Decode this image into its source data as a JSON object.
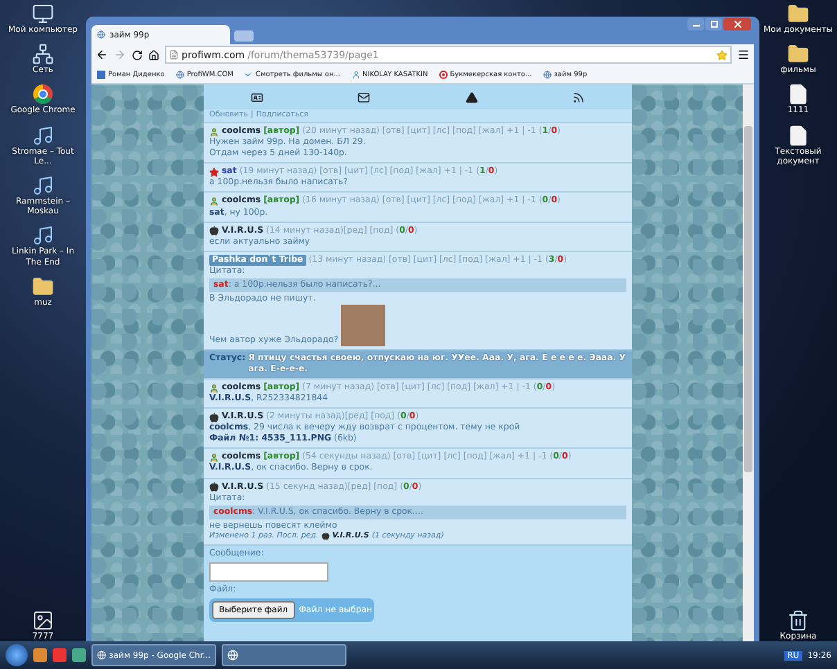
{
  "desktop_left": [
    {
      "kind": "computer",
      "label": "Мой компьютер"
    },
    {
      "kind": "network",
      "label": "Сеть"
    },
    {
      "kind": "chrome",
      "label": "Google Chrome"
    },
    {
      "kind": "audio",
      "label": "Stromae – Tout Le..."
    },
    {
      "kind": "audio",
      "label": "Rammstein – Moskau"
    },
    {
      "kind": "audio",
      "label": "Linkin Park – In The End"
    },
    {
      "kind": "folder",
      "label": "muz"
    },
    {
      "kind": "spacer"
    },
    {
      "kind": "image",
      "label": "7777"
    }
  ],
  "desktop_right": [
    {
      "kind": "docs",
      "label": "Мои документы"
    },
    {
      "kind": "folder",
      "label": "фильмы"
    },
    {
      "kind": "file",
      "label": "1111"
    },
    {
      "kind": "file",
      "label": "Текстовый документ"
    },
    {
      "kind": "spacer"
    },
    {
      "kind": "trash",
      "label": "Корзина"
    }
  ],
  "browser": {
    "tab_title": "займ 99р",
    "url_host": "profiwm.com",
    "url_path": "/forum/thema53739/page1",
    "bookmarks": [
      {
        "kind": "square",
        "label": "Роман Диденко"
      },
      {
        "kind": "globe",
        "label": "ProfiWM.COM"
      },
      {
        "kind": "bird",
        "label": "Смотреть фильмы он..."
      },
      {
        "kind": "person",
        "label": "NIKOLAY KASATKIN"
      },
      {
        "kind": "target",
        "label": "Букмекерская конто..."
      },
      {
        "kind": "globe",
        "label": "займ 99р"
      }
    ]
  },
  "forum": {
    "links": [
      "Обновить",
      "Подписаться"
    ],
    "link_separator": "|",
    "vote_marks": {
      "open": "(",
      "sep": "/",
      "close": ")"
    },
    "posts": [
      {
        "kind": "user",
        "author": "coolcms",
        "tag": "[автор]",
        "meta": "(20 минут назад) [отв] [цит] [лс] [под] [жал] +1 | -1",
        "up": "1",
        "down": "0",
        "body": [
          {
            "kind": "text",
            "text": "Нужен займ 99р. На домен. БЛ 29."
          },
          {
            "kind": "text",
            "text": "Отдам через 5 дней 130-140р."
          }
        ]
      },
      {
        "kind": "star",
        "author": "sat",
        "meta": "(19 минут назад) [отв] [цит] [лс] [под] [жал] +1 | -1",
        "up": "1",
        "down": "0",
        "body": [
          {
            "kind": "text",
            "text": "а 100р.нельзя было написать?"
          }
        ]
      },
      {
        "kind": "user",
        "author": "coolcms",
        "tag": "[автор]",
        "meta": "(16 минут назад) [отв] [цит] [лс] [под] [жал] +1 | -1",
        "up": "0",
        "down": "0",
        "body": [
          {
            "kind": "text",
            "text": "**sat**, ну 100р."
          }
        ]
      },
      {
        "kind": "apple",
        "author": "V.I.R.U.S",
        "meta": "(14 минут назад)[ред] [под]",
        "up": "0",
        "down": "0",
        "body": [
          {
            "kind": "text",
            "text": "если актуально займу"
          }
        ]
      },
      {
        "kind": "plain",
        "author": "Pashka don`t Tribe",
        "meta": "(13 минут назад) [отв] [цит] [лс] [под] [жал] +1 | -1",
        "up": "3",
        "down": "0",
        "body": [
          {
            "kind": "quote_label",
            "text": "Цитата:"
          },
          {
            "kind": "quote",
            "text": "**sat**: а 100р.нельзя было написать?..."
          },
          {
            "kind": "text",
            "text": "В Эльдорадо не пишут."
          },
          {
            "kind": "text_image",
            "text": "Чем автор хуже Эльдорадо?"
          }
        ],
        "status": {
          "label": "Статус:",
          "text": "Я птицу счастья своею, отпускаю на юг. УУее. Ааа. У, ага. Е е е е е. Эааа. У ага. Е-е-е-е."
        }
      },
      {
        "kind": "user",
        "author": "coolcms",
        "tag": "[автор]",
        "meta": "(7 минут назад) [отв] [цит] [лс] [под] [жал] +1 | -1",
        "up": "0",
        "down": "0",
        "body": [
          {
            "kind": "text",
            "text": "**V.I.R.U.S**, R252334821844"
          }
        ]
      },
      {
        "kind": "apple",
        "author": "V.I.R.U.S",
        "meta": "(2 минуты назад)[ред] [под]",
        "up": "0",
        "down": "0",
        "body": [
          {
            "kind": "text",
            "text": "**coolcms**, 29 числа к вечеру жду возврат с процентом. тему не крой"
          },
          {
            "kind": "text",
            "text": "**Файл №1: 4535_111.PNG** (6kb)"
          }
        ]
      },
      {
        "kind": "user",
        "author": "coolcms",
        "tag": "[автор]",
        "meta": "(54 секунды назад) [отв] [цит] [лс] [под] [жал] +1 | -1",
        "up": "0",
        "down": "0",
        "body": [
          {
            "kind": "text",
            "text": "**V.I.R.U.S**, ок спасибо. Верну в срок."
          }
        ]
      },
      {
        "kind": "apple",
        "author": "V.I.R.U.S",
        "meta": "(15 секунд назад)[ред] [под]",
        "up": "0",
        "down": "0",
        "body": [
          {
            "kind": "quote_label",
            "text": "Цитата:"
          },
          {
            "kind": "quote",
            "text": "**coolcms**: V.I.R.U.S, ок спасибо. Верну в срок...."
          },
          {
            "kind": "text",
            "text": "не вернешь повесят клеймо"
          },
          {
            "kind": "edit_note",
            "text": "Изменено 1 раз. Посл. ред.",
            "editor": "V.I.R.U.S",
            "time": "(1 секунду назад)"
          }
        ]
      }
    ],
    "form": {
      "message_label": "Сообщение:",
      "file_label": "Файл:",
      "file_button": "Выберите файл",
      "file_status": "Файл не выбран"
    }
  },
  "taskbar": {
    "tasks": [
      {
        "label": "займ 99р - Google Chr..."
      }
    ],
    "language": "RU",
    "time": "19:26"
  }
}
